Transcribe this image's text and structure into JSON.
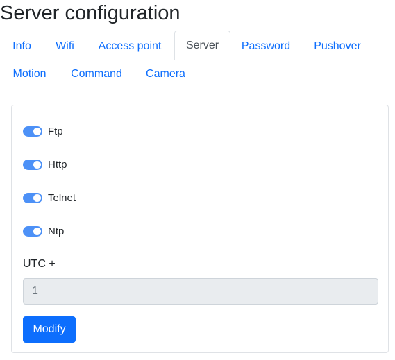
{
  "page": {
    "title": "Server configuration"
  },
  "tabs": [
    {
      "label": "Info",
      "active": false
    },
    {
      "label": "Wifi",
      "active": false
    },
    {
      "label": "Access point",
      "active": false
    },
    {
      "label": "Server",
      "active": true
    },
    {
      "label": "Password",
      "active": false
    },
    {
      "label": "Pushover",
      "active": false
    },
    {
      "label": "Motion",
      "active": false
    },
    {
      "label": "Command",
      "active": false
    },
    {
      "label": "Camera",
      "active": false
    }
  ],
  "server_form": {
    "switches": [
      {
        "label": "Ftp",
        "checked": true
      },
      {
        "label": "Http",
        "checked": true
      },
      {
        "label": "Telnet",
        "checked": true
      },
      {
        "label": "Ntp",
        "checked": true
      }
    ],
    "utc_label": "UTC +",
    "utc_value": "1",
    "modify_label": "Modify"
  },
  "colors": {
    "link": "#0d6efd",
    "switch_on": "#4d91f7",
    "primary_button": "#0d6efd",
    "disabled_input_bg": "#e9ecef"
  }
}
